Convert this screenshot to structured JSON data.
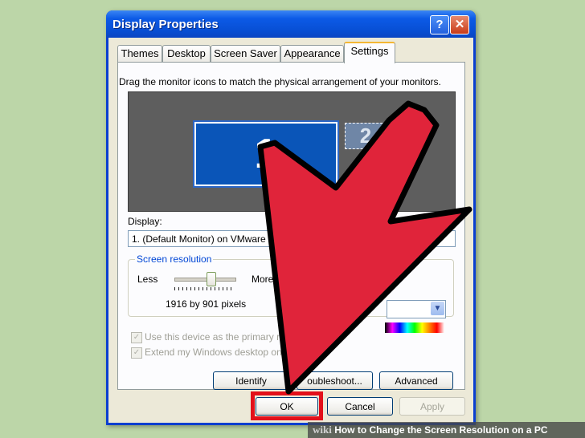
{
  "window": {
    "title": "Display Properties",
    "help_glyph": "?",
    "close_glyph": "✕"
  },
  "tabs": [
    {
      "label": "Themes"
    },
    {
      "label": "Desktop"
    },
    {
      "label": "Screen Saver"
    },
    {
      "label": "Appearance"
    },
    {
      "label": "Settings"
    }
  ],
  "active_tab": "Settings",
  "settings": {
    "instruction": "Drag the monitor icons to match the physical arrangement of your monitors.",
    "monitor1_label": "1",
    "monitor2_label": "2",
    "display_label": "Display:",
    "display_value": "1. (Default Monitor) on VMware SV",
    "resolution": {
      "group_title": "Screen resolution",
      "less": "Less",
      "more": "More",
      "value": "1916 by 901 pixels",
      "slider_level_percent": 62
    },
    "checkboxes": [
      {
        "label": "Use this device as the primary m",
        "checked": true,
        "enabled": false
      },
      {
        "label": "Extend my Windows desktop on",
        "checked": true,
        "enabled": false
      }
    ],
    "buttons": {
      "identify": "Identify",
      "troubleshoot": "oubleshoot...",
      "advanced": "Advanced"
    }
  },
  "dialog_buttons": {
    "ok": "OK",
    "cancel": "Cancel",
    "apply": "Apply"
  },
  "annotations": {
    "arrow_color": "#e0243a",
    "highlight_color": "#e3101a"
  },
  "caption": {
    "wiki": "wiki",
    "text": "How to Change the Screen Resolution on a PC"
  }
}
